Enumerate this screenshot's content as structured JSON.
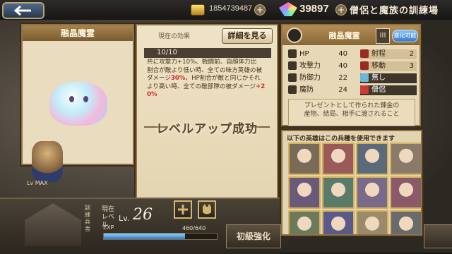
{
  "topbar": {
    "back_icon": "back-arrow-icon",
    "gold": "1854739487",
    "gems": "39897",
    "title": "僧侶と魔族の訓練場"
  },
  "card": {
    "title": "融晶魔霊"
  },
  "effect": {
    "header": "現在の効果",
    "detail_button": "詳細を見る",
    "level": "10/10",
    "line1": "共に攻撃力+10%、戦闘前、自顔体力比",
    "line2": "割合が敵より低い時、全ての味方英雄の被",
    "line3_pre": "ダメージ",
    "line3_red": "30%",
    "line3_post": "、HP割合が敵と同じかそれ",
    "line4_pre": "より高い時、全ての敵部隊の被ダメージ",
    "line4_red": "+2",
    "line5_red": "0%",
    "level_up": "レベルアップ成功"
  },
  "unit": {
    "name": "融晶魔霊",
    "rank": "III",
    "evolve": "進化可能",
    "stats_left": [
      {
        "label": "HP",
        "value": "40"
      },
      {
        "label": "攻撃力",
        "value": "40"
      },
      {
        "label": "防御力",
        "value": "22"
      },
      {
        "label": "魔防",
        "value": "24"
      }
    ],
    "stats_right": [
      {
        "label": "射程",
        "value": "2"
      },
      {
        "label": "移動",
        "value": "3"
      },
      {
        "label": "無し",
        "value": ""
      },
      {
        "label": "僧侶",
        "value": ""
      }
    ],
    "desc1": "プレゼントとして作られた錬金の",
    "desc2": "産物、結局、相手に渡されること"
  },
  "heroes": {
    "header": "以下の英雄はこの兵種を使用できます",
    "colors": [
      "#7a6a5a",
      "#9a5a5a",
      "#5a6a7a",
      "#8a7a6a",
      "#6a5a7a",
      "#5a7a6a",
      "#7a6a8a",
      "#8a5a6a",
      "#6a7a5a",
      "#5a5a8a",
      "#9a8a6a",
      "#6a6a6a"
    ]
  },
  "bottom": {
    "shrine_label": "訓練兵舎",
    "level_label": "現在レベル",
    "level_prefix": "Lv.",
    "level": "26",
    "exp_label": "EXP",
    "exp_text": "460/640",
    "exp_fraction": 0.72,
    "reinforce": "初級強化",
    "lv_badge": "Lv MAX"
  }
}
